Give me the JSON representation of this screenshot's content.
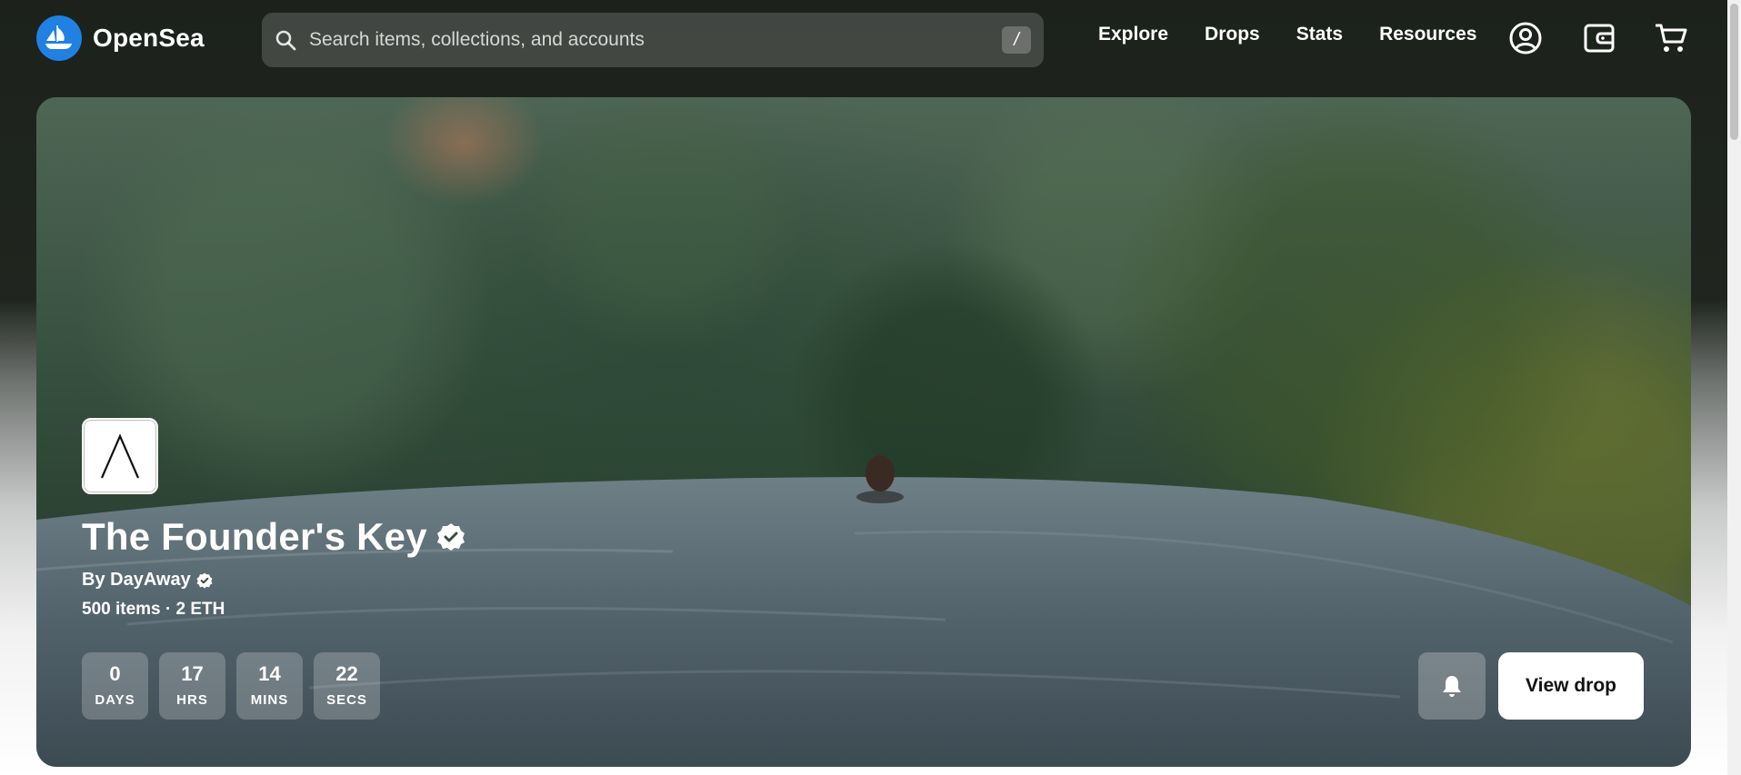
{
  "header": {
    "brand": "OpenSea",
    "search": {
      "placeholder": "Search items, collections, and accounts",
      "shortcut": "/"
    },
    "nav": [
      {
        "label": "Explore"
      },
      {
        "label": "Drops"
      },
      {
        "label": "Stats"
      },
      {
        "label": "Resources"
      }
    ],
    "icons": [
      "account-icon",
      "wallet-icon",
      "cart-icon"
    ]
  },
  "hero": {
    "title": "The Founder's Key",
    "creator": "By DayAway",
    "meta": "500 items · 2 ETH",
    "countdown": [
      {
        "value": "0",
        "label": "DAYS"
      },
      {
        "value": "17",
        "label": "HRS"
      },
      {
        "value": "14",
        "label": "MINS"
      },
      {
        "value": "22",
        "label": "SECS"
      }
    ],
    "cta": "View drop"
  },
  "colors": {
    "brand": "#2081e2",
    "verified": "#ffffff"
  }
}
